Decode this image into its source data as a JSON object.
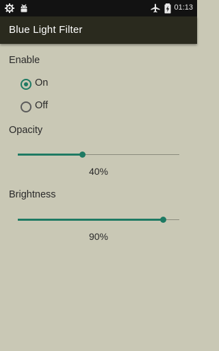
{
  "status_bar": {
    "left_icons": [
      "settings-icon",
      "android-icon"
    ],
    "right_icons": [
      "airplane-mode-icon",
      "battery-charging-icon"
    ],
    "time": "01:13"
  },
  "app_bar": {
    "title": "Blue Light Filter"
  },
  "enable": {
    "label": "Enable",
    "options": [
      {
        "label": "On",
        "selected": true
      },
      {
        "label": "Off",
        "selected": false
      }
    ]
  },
  "opacity": {
    "label": "Opacity",
    "value_text": "40%",
    "value": 40
  },
  "brightness": {
    "label": "Brightness",
    "value_text": "90%",
    "value": 90
  },
  "colors": {
    "accent": "#1e7a63",
    "background": "#c9c8b5",
    "app_bar": "#2a2a1e"
  }
}
